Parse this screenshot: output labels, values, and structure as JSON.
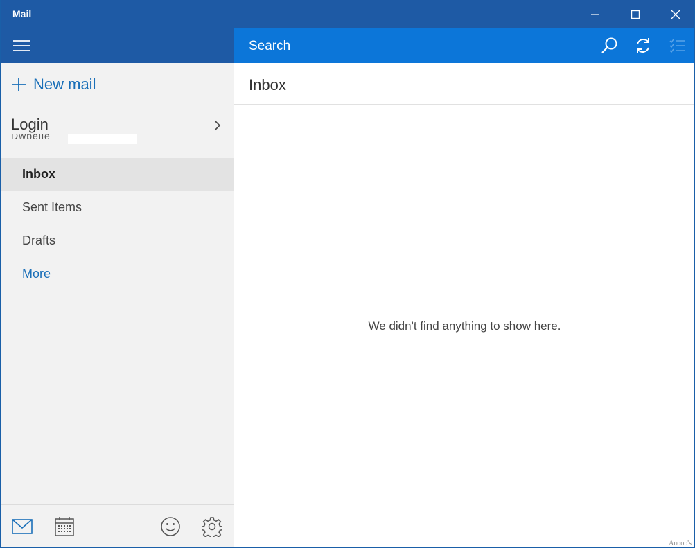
{
  "window": {
    "title": "Mail",
    "controls": {
      "minimize": "minimize",
      "maximize": "maximize",
      "close": "close"
    }
  },
  "header": {
    "search_label": "Search",
    "icons": [
      "hamburger-menu-icon",
      "search-icon",
      "sync-icon",
      "select-mode-icon"
    ]
  },
  "sidebar": {
    "new_mail_label": "New mail",
    "account": {
      "name": "Login",
      "email_partial": "Dwbelle"
    },
    "folders": [
      {
        "label": "Inbox",
        "active": true
      },
      {
        "label": "Sent Items",
        "active": false
      },
      {
        "label": "Drafts",
        "active": false
      }
    ],
    "more_label": "More",
    "footer_icons": [
      "mail-icon",
      "calendar-icon",
      "smiley-feedback-icon",
      "settings-icon"
    ]
  },
  "main": {
    "title": "Inbox",
    "empty_message": "We didn't find anything to show here."
  },
  "watermark": "Anoop's",
  "colors": {
    "titlebar": "#1e5aa5",
    "search_bar": "#0c76d9",
    "accent_link": "#1a6fb8",
    "sidebar_bg": "#f2f2f2",
    "active_folder_bg": "#e3e3e3"
  }
}
